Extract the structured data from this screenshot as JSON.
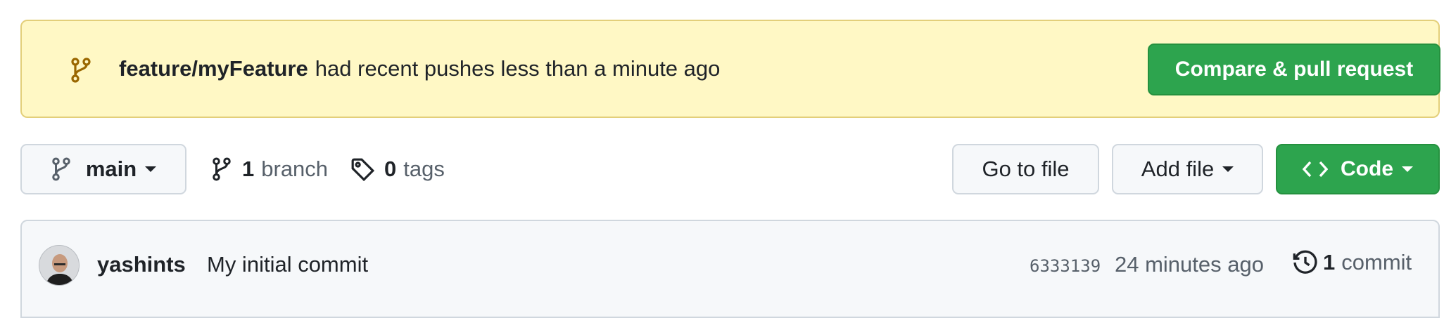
{
  "banner": {
    "branch_name": "feature/myFeature",
    "message": "had recent pushes less than a minute ago",
    "compare_button": "Compare & pull request",
    "icon": "git-branch-icon"
  },
  "toolbar": {
    "current_branch": "main",
    "branch_count": "1",
    "branch_label": "branch",
    "tag_count": "0",
    "tag_label": "tags",
    "goto_file": "Go to file",
    "add_file": "Add file",
    "code": "Code"
  },
  "latest_commit": {
    "author": "yashints",
    "message": "My initial commit",
    "sha": "6333139",
    "time": "24 minutes ago",
    "commit_count": "1",
    "commit_label": "commit"
  },
  "colors": {
    "banner_bg": "#fff8c5",
    "green": "#2da44e",
    "muted": "#57606a"
  }
}
